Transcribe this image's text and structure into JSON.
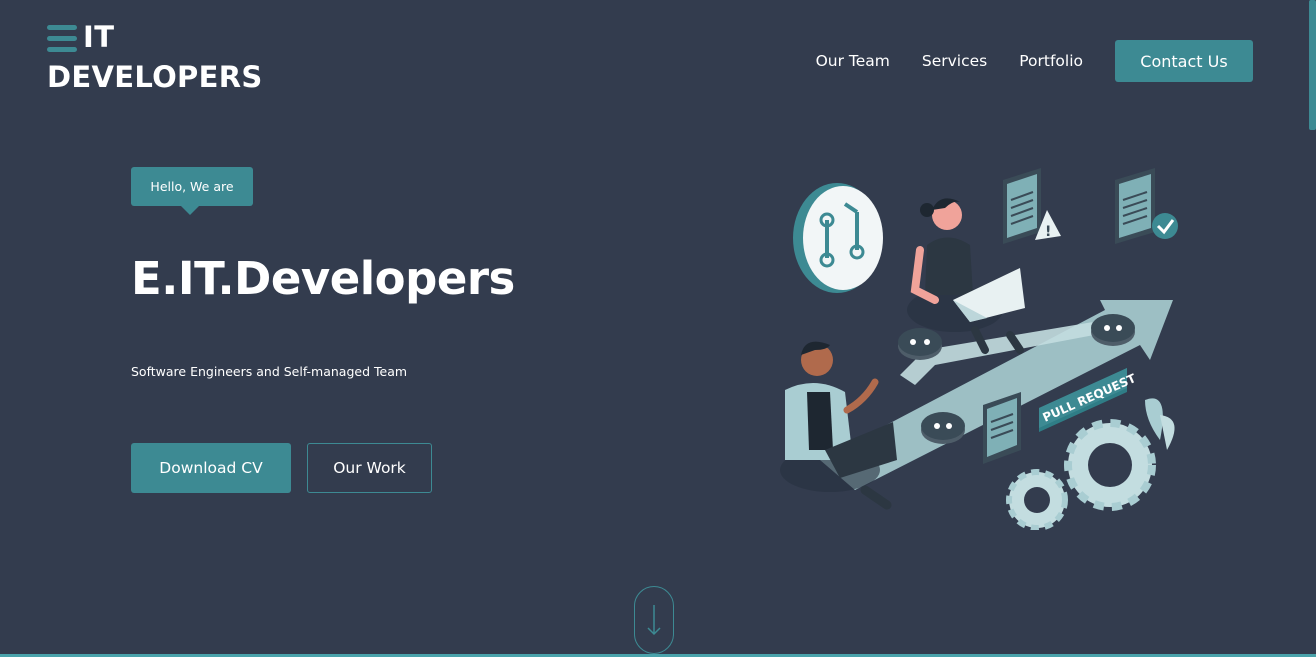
{
  "logo": {
    "line1": "IT",
    "line2": "DEVELOPERS"
  },
  "nav": {
    "links": [
      "Our Team",
      "Services",
      "Portfolio"
    ],
    "cta": "Contact Us"
  },
  "hero": {
    "badge": "Hello, We are",
    "title": "E.IT.Developers",
    "subtitle": "Software Engineers and Self-managed Team",
    "primary_button": "Download CV",
    "secondary_button": "Our Work"
  },
  "illustration": {
    "banner_text": "PULL REQUEST"
  },
  "icons": {
    "menu": "hamburger-icon",
    "scroll": "arrow-down-icon"
  },
  "colors": {
    "background": "#333c4e",
    "accent": "#3d8a93",
    "text": "#ffffff"
  }
}
